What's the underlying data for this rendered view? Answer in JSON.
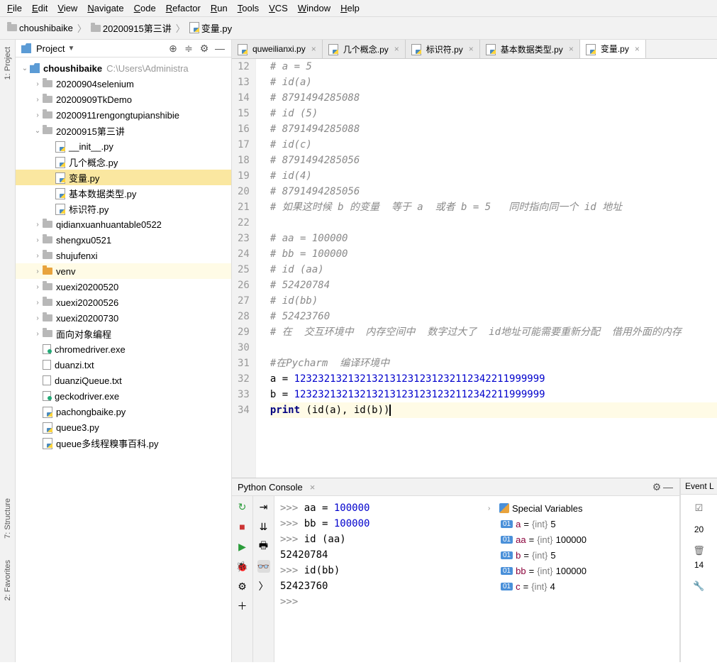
{
  "menu": [
    "File",
    "Edit",
    "View",
    "Navigate",
    "Code",
    "Refactor",
    "Run",
    "Tools",
    "VCS",
    "Window",
    "Help"
  ],
  "breadcrumb": {
    "root": "choushibaike",
    "folder": "20200915第三讲",
    "file": "变量.py"
  },
  "project_panel": {
    "title": "Project",
    "root_name": "choushibaike",
    "root_hint": "C:\\Users\\Administra"
  },
  "tree": [
    {
      "d": 0,
      "tw": "v",
      "ico": "proj",
      "lbl": "choushibaike",
      "bold": true,
      "hint": "C:\\Users\\Administra"
    },
    {
      "d": 1,
      "tw": ">",
      "ico": "folder",
      "lbl": "20200904selenium"
    },
    {
      "d": 1,
      "tw": ">",
      "ico": "folder",
      "lbl": "20200909TkDemo"
    },
    {
      "d": 1,
      "tw": ">",
      "ico": "folder",
      "lbl": "20200911rengongtupianshibie"
    },
    {
      "d": 1,
      "tw": "v",
      "ico": "folder",
      "lbl": "20200915第三讲"
    },
    {
      "d": 2,
      "tw": "",
      "ico": "py",
      "lbl": "__init__.py"
    },
    {
      "d": 2,
      "tw": "",
      "ico": "py",
      "lbl": "几个概念.py"
    },
    {
      "d": 2,
      "tw": "",
      "ico": "py",
      "lbl": "变量.py",
      "sel": true
    },
    {
      "d": 2,
      "tw": "",
      "ico": "py",
      "lbl": "基本数据类型.py"
    },
    {
      "d": 2,
      "tw": "",
      "ico": "py",
      "lbl": "标识符.py"
    },
    {
      "d": 1,
      "tw": ">",
      "ico": "folder",
      "lbl": "qidianxuanhuantable0522"
    },
    {
      "d": 1,
      "tw": ">",
      "ico": "folder",
      "lbl": "shengxu0521"
    },
    {
      "d": 1,
      "tw": ">",
      "ico": "folder",
      "lbl": "shujufenxi"
    },
    {
      "d": 1,
      "tw": ">",
      "ico": "venv",
      "lbl": "venv",
      "venv": true
    },
    {
      "d": 1,
      "tw": ">",
      "ico": "folder",
      "lbl": "xuexi20200520"
    },
    {
      "d": 1,
      "tw": ">",
      "ico": "folder",
      "lbl": "xuexi20200526"
    },
    {
      "d": 1,
      "tw": ">",
      "ico": "folder",
      "lbl": "xuexi20200730"
    },
    {
      "d": 1,
      "tw": ">",
      "ico": "folder",
      "lbl": "面向对象编程"
    },
    {
      "d": 1,
      "tw": "",
      "ico": "exe",
      "lbl": "chromedriver.exe"
    },
    {
      "d": 1,
      "tw": "",
      "ico": "txt",
      "lbl": "duanzi.txt"
    },
    {
      "d": 1,
      "tw": "",
      "ico": "txt",
      "lbl": "duanziQueue.txt"
    },
    {
      "d": 1,
      "tw": "",
      "ico": "exe",
      "lbl": "geckodriver.exe"
    },
    {
      "d": 1,
      "tw": "",
      "ico": "py",
      "lbl": "pachongbaike.py"
    },
    {
      "d": 1,
      "tw": "",
      "ico": "py",
      "lbl": "queue3.py"
    },
    {
      "d": 1,
      "tw": "",
      "ico": "py",
      "lbl": "queue多线程糗事百科.py"
    }
  ],
  "tabs": [
    {
      "label": "quweilianxi.py",
      "active": false
    },
    {
      "label": "几个概念.py",
      "active": false
    },
    {
      "label": "标识符.py",
      "active": false
    },
    {
      "label": "基本数据类型.py",
      "active": false
    },
    {
      "label": "变量.py",
      "active": true
    }
  ],
  "code": {
    "start": 12,
    "lines": [
      {
        "cls": "comment",
        "t": "# a = 5"
      },
      {
        "cls": "comment",
        "t": "# id(a)"
      },
      {
        "cls": "comment",
        "t": "# 8791494285088"
      },
      {
        "cls": "comment",
        "t": "# id (5)"
      },
      {
        "cls": "comment",
        "t": "# 8791494285088"
      },
      {
        "cls": "comment",
        "t": "# id(c)"
      },
      {
        "cls": "comment",
        "t": "# 8791494285056"
      },
      {
        "cls": "comment",
        "t": "# id(4)"
      },
      {
        "cls": "comment",
        "t": "# 8791494285056"
      },
      {
        "cls": "comment",
        "t": "# 如果这时候 b 的变量  等于 a  或者 b = 5   同时指向同一个 id 地址"
      },
      {
        "cls": "",
        "t": ""
      },
      {
        "cls": "comment",
        "t": "# aa = 100000"
      },
      {
        "cls": "comment",
        "t": "# bb = 100000"
      },
      {
        "cls": "comment",
        "t": "# id (aa)"
      },
      {
        "cls": "comment",
        "t": "# 52420784"
      },
      {
        "cls": "comment",
        "t": "# id(bb)"
      },
      {
        "cls": "comment",
        "t": "# 52423760"
      },
      {
        "cls": "comment",
        "t": "# 在  交互环境中  内存空间中  数字过大了  id地址可能需要重新分配  借用外面的内存"
      },
      {
        "cls": "",
        "t": ""
      },
      {
        "cls": "comment",
        "t": "#在Pycharm  编译环境中"
      },
      {
        "cls": "code",
        "t": "a = 123232132132132131231231232112342211999999"
      },
      {
        "cls": "code",
        "t": "b = 123232132132132131231231232112342211999999"
      },
      {
        "cls": "code-cur",
        "t": "print (id(a), id(b))"
      }
    ]
  },
  "console": {
    "title": "Python Console",
    "lines": [
      {
        "p": ">>> ",
        "c": "aa = ",
        "n": "100000"
      },
      {
        "p": ">>> ",
        "c": "bb = ",
        "n": "100000"
      },
      {
        "p": ">>> ",
        "c": "id (aa)",
        "n": ""
      },
      {
        "p": "",
        "c": "52420784",
        "n": ""
      },
      {
        "p": ">>> ",
        "c": "id(bb)",
        "n": ""
      },
      {
        "p": "",
        "c": "52423760",
        "n": ""
      },
      {
        "p": "",
        "c": "",
        "n": ""
      },
      {
        "p": ">>> ",
        "c": "",
        "n": ""
      }
    ]
  },
  "vars": {
    "title": "Special Variables",
    "items": [
      {
        "k": "a",
        "t": "{int}",
        "v": "5"
      },
      {
        "k": "aa",
        "t": "{int}",
        "v": "100000"
      },
      {
        "k": "b",
        "t": "{int}",
        "v": "5"
      },
      {
        "k": "bb",
        "t": "{int}",
        "v": "100000"
      },
      {
        "k": "c",
        "t": "{int}",
        "v": "4"
      }
    ]
  },
  "event": {
    "title": "Event L",
    "lines": [
      "20",
      "14"
    ]
  },
  "sidetabs": {
    "project": "1: Project",
    "structure": "7: Structure",
    "favorites": "2: Favorites"
  }
}
